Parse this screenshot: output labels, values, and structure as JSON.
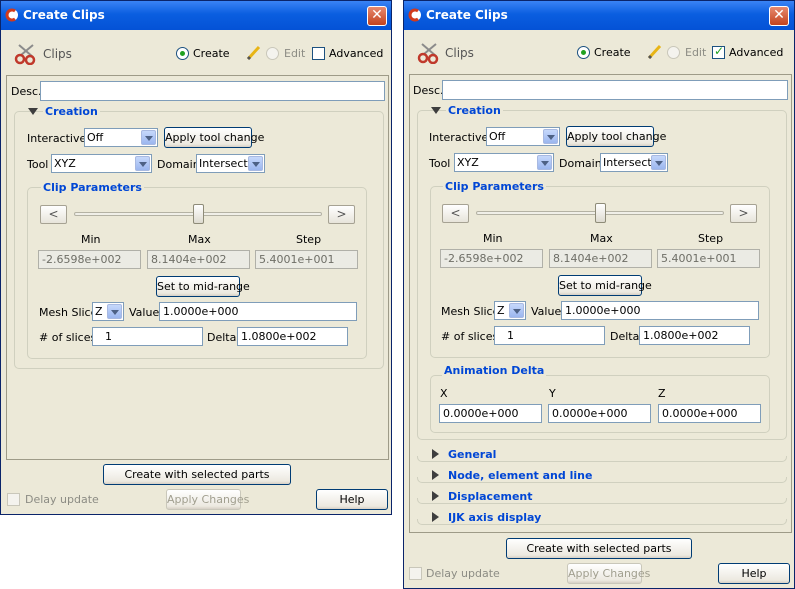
{
  "window": {
    "title": "Create Clips",
    "close_glyph": "✕",
    "icon": "app-logo-icon"
  },
  "toolbar": {
    "section_label": "Clips",
    "create_label": "Create",
    "edit_label": "Edit",
    "advanced_label": "Advanced"
  },
  "desc": {
    "label": "Desc.",
    "value": ""
  },
  "creation": {
    "title": "Creation",
    "interactive_label": "Interactive",
    "interactive_value": "Off",
    "apply_tool_label": "Apply tool change",
    "tool_label": "Tool",
    "tool_value": "XYZ",
    "domain_label": "Domain",
    "domain_value": "Intersect"
  },
  "clip_params": {
    "title": "Clip Parameters",
    "prev_glyph": "<",
    "next_glyph": ">",
    "slider_fraction": 0.5,
    "min_label": "Min",
    "max_label": "Max",
    "step_label": "Step",
    "min_value": "-2.6598e+002",
    "max_value": "8.1404e+002",
    "step_value": "5.4001e+001",
    "midrange_label": "Set to mid-range",
    "mesh_slice_label": "Mesh Slice",
    "mesh_slice_value": "Z",
    "value_label": "Value",
    "value_value": "1.0000e+000",
    "slices_label": "# of slices",
    "slices_value": "1",
    "delta_label": "Delta",
    "delta_value": "1.0800e+002"
  },
  "animation_delta": {
    "title": "Animation Delta",
    "x_label": "X",
    "y_label": "Y",
    "z_label": "Z",
    "x_value": "0.0000e+000",
    "y_value": "0.0000e+000",
    "z_value": "0.0000e+000"
  },
  "collapsed_sections": [
    "General",
    "Node, element and line",
    "Displacement",
    "IJK axis display"
  ],
  "footer": {
    "create_label": "Create with selected parts",
    "delay_label": "Delay update",
    "apply_label": "Apply Changes",
    "help_label": "Help"
  },
  "colors": {
    "title_bar": "#0a5ee0",
    "section_title": "#0046d5",
    "window_bg": "#ece9d8",
    "radio_on": "#21a121"
  }
}
